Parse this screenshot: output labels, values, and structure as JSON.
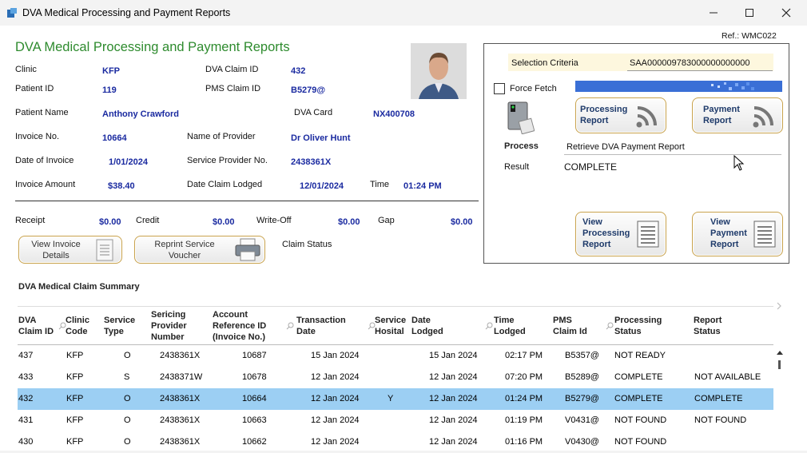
{
  "window": {
    "title": "DVA  Medical Processing and Payment Reports",
    "ref": "Ref.: WMC022"
  },
  "header": {
    "title": "DVA  Medical Processing and Payment Reports"
  },
  "fields": {
    "clinic_label": "Clinic",
    "clinic": "KFP",
    "dva_claim_id_label": "DVA Claim ID",
    "dva_claim_id": "432",
    "patient_id_label": "Patient ID",
    "patient_id": "119",
    "pms_claim_id_label": "PMS Claim ID",
    "pms_claim_id": "B5279@",
    "patient_name_label": "Patient Name",
    "patient_name": "Anthony Crawford",
    "dva_card_label": "DVA Card",
    "dva_card": "NX400708",
    "invoice_no_label": "Invoice No.",
    "invoice_no": "10664",
    "provider_name_label": "Name of Provider",
    "provider_name": "Dr Oliver Hunt",
    "invoice_date_label": "Date of Invoice",
    "invoice_date": "1/01/2024",
    "provider_no_label": "Service Provider No.",
    "provider_no": "2438361X",
    "invoice_amount_label": "Invoice Amount",
    "invoice_amount": "$38.40",
    "date_lodged_label": "Date Claim Lodged",
    "date_lodged": "12/01/2024",
    "time_label": "Time",
    "time": "01:24 PM",
    "receipt_label": "Receipt",
    "receipt": "$0.00",
    "credit_label": "Credit",
    "credit": "$0.00",
    "writeoff_label": "Write-Off",
    "writeoff": "$0.00",
    "gap_label": "Gap",
    "gap": "$0.00",
    "claim_status_label": "Claim Status"
  },
  "buttons": {
    "view_invoice": "View Invoice\nDetails",
    "reprint_voucher": "Reprint Service\nVoucher",
    "processing_report": "Processing\nReport",
    "payment_report": "Payment\nReport",
    "view_processing_report": "View\nProcessing\nReport",
    "view_payment_report": "View\nPayment\nReport"
  },
  "panel": {
    "selection_criteria_label": "Selection Criteria",
    "selection_criteria": "SAA000009783000000000000",
    "force_fetch_label": "Force Fetch",
    "process_label": "Process",
    "process_value": "Retrieve DVA Payment Report",
    "result_label": "Result",
    "result_value": "COMPLETE"
  },
  "summary": {
    "title": "DVA Medical Claim Summary",
    "columns": [
      "DVA\nClaim ID",
      "Clinic\nCode",
      "Service\nType",
      "Sericing\nProvider\nNumber",
      "Account\nReference ID\n(Invoice No.)",
      "Transaction\nDate",
      "Service\nHosital",
      "Date\nLodged",
      "Time\nLodged",
      "PMS\nClaim Id",
      "Processing\nStatus",
      "Report\nStatus"
    ],
    "rows": [
      [
        "437",
        "KFP",
        "O",
        "2438361X",
        "10687",
        "15 Jan 2024",
        "",
        "15 Jan 2024",
        "02:17 PM",
        "B5357@",
        "NOT READY",
        ""
      ],
      [
        "433",
        "KFP",
        "S",
        "2438371W",
        "10678",
        "12 Jan 2024",
        "",
        "12 Jan 2024",
        "07:20 PM",
        "B5289@",
        "COMPLETE",
        "NOT AVAILABLE"
      ],
      [
        "432",
        "KFP",
        "O",
        "2438361X",
        "10664",
        "12 Jan 2024",
        "Y",
        "12 Jan 2024",
        "01:24 PM",
        "B5279@",
        "COMPLETE",
        "COMPLETE"
      ],
      [
        "431",
        "KFP",
        "O",
        "2438361X",
        "10663",
        "12 Jan 2024",
        "",
        "12 Jan 2024",
        "01:19 PM",
        "V0431@",
        "NOT FOUND",
        "NOT FOUND"
      ],
      [
        "430",
        "KFP",
        "O",
        "2438361X",
        "10662",
        "12 Jan 2024",
        "",
        "12 Jan 2024",
        "01:16 PM",
        "V0430@",
        "NOT FOUND",
        ""
      ]
    ],
    "selected_row": 2
  },
  "colors": {
    "accent_title": "#2e8b2e",
    "value_text": "#1a2aa0",
    "selected_row": "#9ccff3",
    "button_border": "#c8a24c"
  }
}
